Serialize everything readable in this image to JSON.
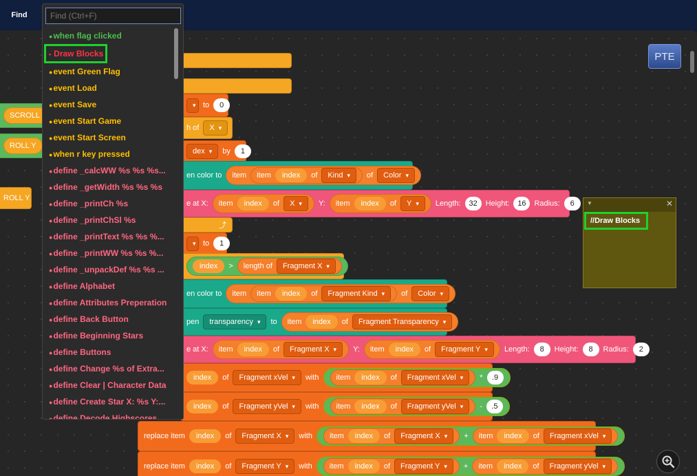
{
  "topbar": {
    "find_tab_label": "Find"
  },
  "search": {
    "placeholder": "Find (Ctrl+F)"
  },
  "find_results": [
    {
      "label": "when flag clicked",
      "color": "#4cbf4c",
      "bullet": "●"
    },
    {
      "label": "Draw Blocks",
      "color": "#ff3344",
      "bullet": "•"
    },
    {
      "label": "event Green Flag",
      "color": "#ffbf00",
      "bullet": "●"
    },
    {
      "label": "event Load",
      "color": "#ffbf00",
      "bullet": "●"
    },
    {
      "label": "event Save",
      "color": "#ffbf00",
      "bullet": "●"
    },
    {
      "label": "event Start Game",
      "color": "#ffbf00",
      "bullet": "●"
    },
    {
      "label": "event Start Screen",
      "color": "#ffbf00",
      "bullet": "●"
    },
    {
      "label": "when r key pressed",
      "color": "#ffbf00",
      "bullet": "●"
    },
    {
      "label": "define _calcWW %s %s %s...",
      "color": "#ff6680",
      "bullet": "●"
    },
    {
      "label": "define _getWidth %s %s %s",
      "color": "#ff6680",
      "bullet": "●"
    },
    {
      "label": "define _printCh %s",
      "color": "#ff6680",
      "bullet": "●"
    },
    {
      "label": "define _printChSl %s",
      "color": "#ff6680",
      "bullet": "●"
    },
    {
      "label": "define _printText %s %s %...",
      "color": "#ff6680",
      "bullet": "●"
    },
    {
      "label": "define _printWW %s %s %...",
      "color": "#ff6680",
      "bullet": "●"
    },
    {
      "label": "define _unpackDef %s %s ...",
      "color": "#ff6680",
      "bullet": "●"
    },
    {
      "label": "define Alphabet",
      "color": "#ff6680",
      "bullet": "●"
    },
    {
      "label": "define Attributes Preperation",
      "color": "#ff6680",
      "bullet": "●"
    },
    {
      "label": "define Back Button",
      "color": "#ff6680",
      "bullet": "●"
    },
    {
      "label": "define Beginning Stars",
      "color": "#ff6680",
      "bullet": "●"
    },
    {
      "label": "define Buttons",
      "color": "#ff6680",
      "bullet": "●"
    },
    {
      "label": "define Change %s of Extra...",
      "color": "#ff6680",
      "bullet": "●"
    },
    {
      "label": "define Clear | Character Data",
      "color": "#ff6680",
      "bullet": "●"
    },
    {
      "label": "define Create Star X: %s Y:...",
      "color": "#ff6680",
      "bullet": "●"
    },
    {
      "label": "define Decode Highscores",
      "color": "#ff6680",
      "bullet": "●"
    }
  ],
  "workspace": {
    "pte_label": "PTE",
    "comment_text": "//Draw Blocks",
    "left_blocks": [
      "SCROLL Y",
      "ROLL Y",
      "/",
      "ROLL Y"
    ],
    "labels": {
      "to": "to",
      "of": "of",
      "by": "by",
      "item": "item",
      "index": "index",
      "Y_colon": "Y:",
      "length": "Length:",
      "height": "Height:",
      "radius": "Radius:",
      "with": "with",
      "replace_item": "replace item",
      "length_of": "length of",
      "gt": ">",
      "to2": "to",
      "plus": "+",
      "minus": "-",
      "times": "*",
      "pen_color_frag": "pen color to",
      "en_color": "en color to",
      "pen_trans": "pen",
      "at_x": "e at X:",
      "h_of": "h of",
      "dex": "dex"
    },
    "values": {
      "zero": "0",
      "one": "1",
      "one_b": "1",
      "len1": "32",
      "h1": "16",
      "r1": "6",
      "len2": "8",
      "h2": "8",
      "r2": "2",
      "mul": ".9",
      "sub": ".5"
    },
    "lists": {
      "X": "X",
      "Kind": "Kind",
      "Color": "Color",
      "Y": "Y",
      "FragX": "Fragment X",
      "FragKind": "Fragment Kind",
      "FragTrans": "Fragment Transparency",
      "FragY": "Fragment Y",
      "FragXVel": "Fragment xVel",
      "FragYVel": "Fragment yVel",
      "transparency": "transparency"
    }
  },
  "colors": {
    "find_selected_border": "#1fd12a",
    "workspace_bg": "#262626",
    "topbar_bg": "#0f1f3d"
  }
}
